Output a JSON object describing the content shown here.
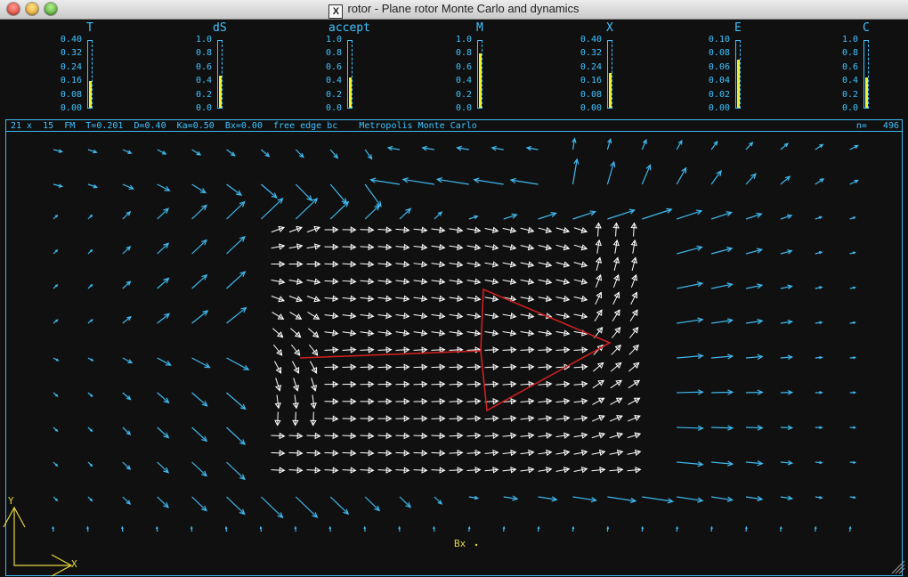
{
  "window": {
    "title": "rotor - Plane rotor Monte Carlo and dynamics",
    "x_logo": "X"
  },
  "meters": [
    {
      "label": "T",
      "ticks": [
        "0.40",
        "0.32",
        "0.24",
        "0.16",
        "0.08",
        "0.00"
      ],
      "level": 0.4
    },
    {
      "label": "dS",
      "ticks": [
        "1.0",
        "0.8",
        "0.6",
        "0.4",
        "0.2",
        "0.0"
      ],
      "level": 0.48
    },
    {
      "label": "accept",
      "ticks": [
        "1.0",
        "0.8",
        "0.6",
        "0.4",
        "0.2",
        "0.0"
      ],
      "level": 0.46
    },
    {
      "label": "M",
      "ticks": [
        "1.0",
        "0.8",
        "0.6",
        "0.4",
        "0.2",
        "0.0"
      ],
      "level": 0.82
    },
    {
      "label": "X",
      "ticks": [
        "0.40",
        "0.32",
        "0.24",
        "0.16",
        "0.08",
        "0.00"
      ],
      "level": 0.52
    },
    {
      "label": "E",
      "ticks": [
        "0.10",
        "0.08",
        "0.06",
        "0.04",
        "0.02",
        "0.00"
      ],
      "level": 0.72
    },
    {
      "label": "C",
      "ticks": [
        "1.0",
        "0.8",
        "0.6",
        "0.4",
        "0.2",
        "0.0"
      ],
      "level": 0.46
    }
  ],
  "status": {
    "text": "21 x  15  FM  T=0.201  D=0.40  Ka=0.50  Bx=0.00  free edge bc    Metropolis Monte Carlo",
    "count": "n=   496"
  },
  "axes": {
    "y_label": "Y",
    "x_label": "X",
    "field_label": "Bx"
  },
  "colors": {
    "meter_text": "#3fc3ff",
    "bar_fill": "#f0f030",
    "outer_arrows": "#3fb8ee",
    "inner_arrows": "#ffffff",
    "triangle": "#cc2020",
    "axes": "#e6d640",
    "background": "#101010"
  }
}
